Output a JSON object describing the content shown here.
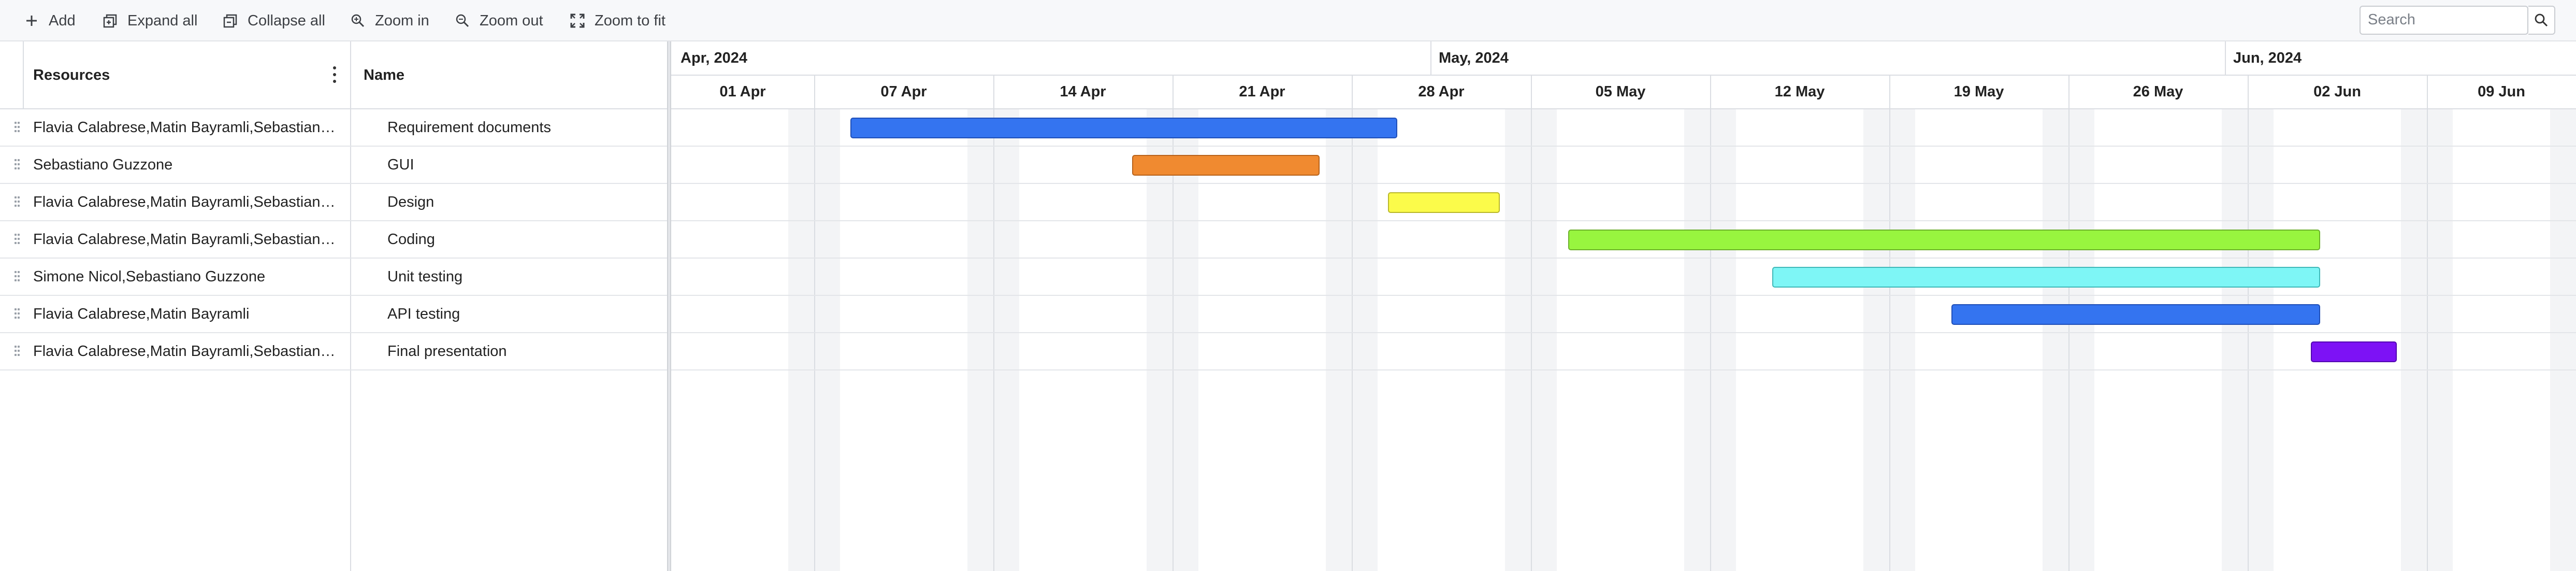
{
  "toolbar": {
    "add_label": "Add",
    "expand_label": "Expand all",
    "collapse_label": "Collapse all",
    "zoom_in_label": "Zoom in",
    "zoom_out_label": "Zoom out",
    "zoom_fit_label": "Zoom to fit",
    "search_placeholder": "Search"
  },
  "grid": {
    "columns": {
      "resources": "Resources",
      "name": "Name"
    },
    "rows": [
      {
        "resources": "Flavia Calabrese,Matin Bayramli,Sebastiano Guzzone",
        "name": "Requirement documents"
      },
      {
        "resources": "Sebastiano Guzzone",
        "name": "GUI"
      },
      {
        "resources": "Flavia Calabrese,Matin Bayramli,Sebastiano Guzzone",
        "name": "Design"
      },
      {
        "resources": "Flavia Calabrese,Matin Bayramli,Sebastiano Guzzone",
        "name": "Coding"
      },
      {
        "resources": "Simone Nicol,Sebastiano Guzzone",
        "name": "Unit testing"
      },
      {
        "resources": "Flavia Calabrese,Matin Bayramli",
        "name": "API testing"
      },
      {
        "resources": "Flavia Calabrese,Matin Bayramli,Sebastiano Guzzone",
        "name": "Final presentation"
      }
    ]
  },
  "timeline": {
    "months": [
      "Apr, 2024",
      "May, 2024",
      "Jun, 2024"
    ],
    "weeks": [
      "01 Apr",
      "07 Apr",
      "14 Apr",
      "21 Apr",
      "28 Apr",
      "05 May",
      "12 May",
      "19 May",
      "26 May",
      "02 Jun",
      "09 Jun"
    ],
    "tasks": [
      {
        "name": "Requirement documents",
        "color": "#3474f0",
        "border": "#1f4fb8"
      },
      {
        "name": "GUI",
        "color": "#f08a30",
        "border": "#b8621a"
      },
      {
        "name": "Design",
        "color": "#fbfb4a",
        "border": "#b9b82a"
      },
      {
        "name": "Coding",
        "color": "#98f53f",
        "border": "#6cb12a"
      },
      {
        "name": "Unit testing",
        "color": "#7ef6f6",
        "border": "#3fb8b8"
      },
      {
        "name": "API testing",
        "color": "#3474f0",
        "border": "#1f4fb8"
      },
      {
        "name": "Final presentation",
        "color": "#7d12f5",
        "border": "#5208b0"
      }
    ]
  }
}
